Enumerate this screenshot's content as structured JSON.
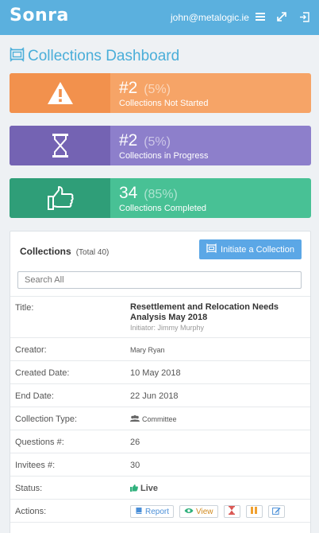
{
  "header": {
    "brand": "Sonra",
    "user_email": "john@metalogic.ie"
  },
  "page": {
    "title": "Collections Dashboard"
  },
  "summary_cards": [
    {
      "number": "#2",
      "percent": "(5%)",
      "label": "Collections Not Started",
      "icon": "warning-icon",
      "color": "#f6a467"
    },
    {
      "number": "#2",
      "percent": "(5%)",
      "label": "Collections in Progress",
      "icon": "hourglass-icon",
      "color": "#8d7fcb"
    },
    {
      "number": "34",
      "percent": "(85%)",
      "label": "Collections Completed",
      "icon": "thumbs-up-icon",
      "color": "#48c195"
    }
  ],
  "collections": {
    "title": "Collections",
    "total": "(Total 40)",
    "initiate_label": "Initiate a Collection",
    "search_placeholder": "Search All",
    "search_value": "",
    "rows": {
      "title": {
        "label": "Title:",
        "value": "Resettlement and Relocation Needs Analysis May 2018",
        "initiator": "Initiator: Jimmy Murphy"
      },
      "creator": {
        "label": "Creator:",
        "value": "Mary Ryan"
      },
      "created": {
        "label": "Created Date:",
        "value": "10 May 2018"
      },
      "end": {
        "label": "End Date:",
        "value": "22 Jun 2018"
      },
      "type": {
        "label": "Collection Type:",
        "value": "Committee"
      },
      "questions": {
        "label": "Questions #:",
        "value": "26"
      },
      "invitees": {
        "label": "Invitees #:",
        "value": "30"
      },
      "status": {
        "label": "Status:",
        "value": "Live"
      },
      "actions": {
        "label": "Actions:",
        "report": "Report",
        "view": "View"
      }
    }
  }
}
